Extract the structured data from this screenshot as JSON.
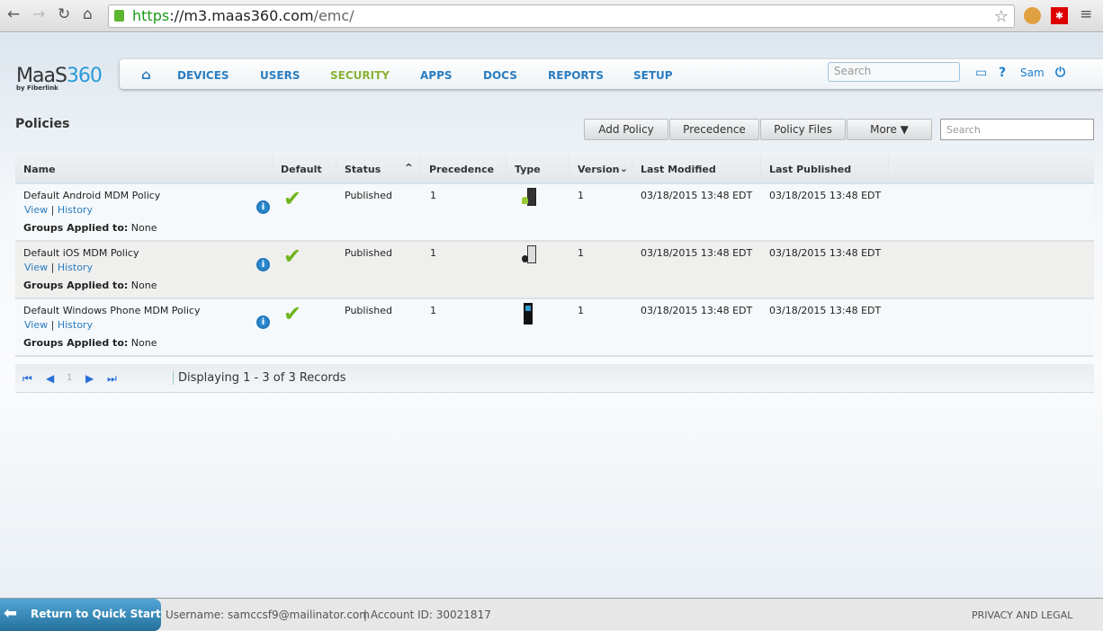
{
  "browser": {
    "url_scheme": "https",
    "url_host": "://m3.maas360.com",
    "url_path": "/emc/"
  },
  "logo": {
    "brand": "MaaS",
    "brand_num": "360",
    "sub": "by Fiberlink"
  },
  "nav": {
    "items": [
      "DEVICES",
      "USERS",
      "SECURITY",
      "APPS",
      "DOCS",
      "REPORTS",
      "SETUP"
    ],
    "active": "SECURITY",
    "search_placeholder": "Search",
    "user": "Sam"
  },
  "page": {
    "title": "Policies",
    "buttons": [
      "Add Policy",
      "Precedence",
      "Policy Files",
      "More ▼"
    ],
    "search_placeholder": "Search"
  },
  "table": {
    "columns": [
      "Name",
      "Default",
      "Status",
      "Precedence",
      "Type",
      "Version",
      "Last Modified",
      "Last Published"
    ],
    "rows": [
      {
        "name": "Default Android MDM Policy",
        "view": "View",
        "history": "History",
        "groups_label": "Groups Applied to:",
        "groups": "None",
        "status": "Published",
        "precedence": "1",
        "type": "android",
        "version": "1",
        "modified": "03/18/2015 13:48 EDT",
        "published": "03/18/2015 13:48 EDT"
      },
      {
        "name": "Default iOS MDM Policy",
        "view": "View",
        "history": "History",
        "groups_label": "Groups Applied to:",
        "groups": "None",
        "status": "Published",
        "precedence": "1",
        "type": "ios",
        "version": "1",
        "modified": "03/18/2015 13:48 EDT",
        "published": "03/18/2015 13:48 EDT"
      },
      {
        "name": "Default Windows Phone MDM Policy",
        "view": "View",
        "history": "History",
        "groups_label": "Groups Applied to:",
        "groups": "None",
        "status": "Published",
        "precedence": "1",
        "type": "windows-phone",
        "version": "1",
        "modified": "03/18/2015 13:48 EDT",
        "published": "03/18/2015 13:48 EDT"
      }
    ]
  },
  "pager": {
    "page": "1",
    "text": "Displaying 1 - 3 of 3 Records"
  },
  "footer": {
    "quick_start": "Return to Quick Start",
    "username": "Username:  samccsf9@mailinator.com",
    "account": "| Account ID:  30021817",
    "privacy": "PRIVACY AND LEGAL"
  }
}
